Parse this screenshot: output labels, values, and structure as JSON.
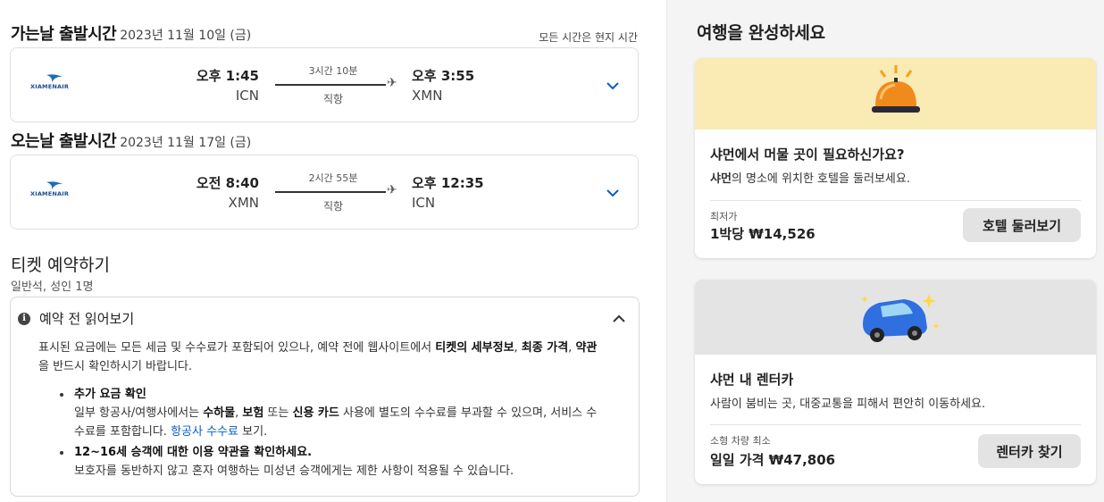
{
  "outbound": {
    "heading": "가는날 출발시간",
    "date": "2023년 11월 10일 (금)",
    "timezone_note": "모든 시간은 현지 시간",
    "airline": "XIAMENAIR",
    "depart_time": "오후 1:45",
    "depart_code": "ICN",
    "duration": "3시간 10분",
    "stops": "직항",
    "arrive_time": "오후 3:55",
    "arrive_code": "XMN"
  },
  "inbound": {
    "heading": "오는날 출발시간",
    "date": "2023년 11월 17일 (금)",
    "airline": "XIAMENAIR",
    "depart_time": "오전 8:40",
    "depart_code": "XMN",
    "duration": "2시간 55분",
    "stops": "직항",
    "arrive_time": "오후 12:35",
    "arrive_code": "ICN"
  },
  "ticket": {
    "title": "티켓 예약하기",
    "subtitle": "일반석, 성인 1명"
  },
  "notice": {
    "title": "예약 전 읽어보기",
    "intro_1": "표시된 요금에는 모든 세금 및 수수료가 포함되어 있으나, 예약 전에 웹사이트에서 ",
    "intro_bold_1": "티켓의 세부정보",
    "intro_2": ", ",
    "intro_bold_2": "최종 가격",
    "intro_3": ", ",
    "intro_bold_3": "약관",
    "intro_4": "을 반드시 확인하시기 바랍니다.",
    "bullet1_title": "추가 요금 확인",
    "bullet1_text_1": "일부 항공사/여행사에서는 ",
    "bullet1_bold_1": "수하물",
    "bullet1_text_2": ", ",
    "bullet1_bold_2": "보험",
    "bullet1_text_3": " 또는 ",
    "bullet1_bold_3": "신용 카드",
    "bullet1_text_4": " 사용에 별도의 수수료를 부과할 수 있으며, 서비스 수수료를 포함합니다. ",
    "bullet1_link": "항공사 수수료",
    "bullet1_text_5": " 보기.",
    "bullet2_title": "12~16세 승객에 대한 이용 약관을 확인하세요.",
    "bullet2_text": "보호자를 동반하지 않고 혼자 여행하는 미성년 승객에게는 제한 사항이 적용될 수 있습니다."
  },
  "sidebar": {
    "title": "여행을 완성하세요",
    "hotel": {
      "title": "샤먼에서 머물 곳이 필요하신가요?",
      "desc_bold": "샤먼",
      "desc": "의 명소에 위치한 호텔을 둘러보세요.",
      "price_label": "최저가",
      "price": "1박당 ₩14,526",
      "button": "호텔 둘러보기",
      "hero_color": "#faeab4"
    },
    "car": {
      "title": "샤먼 내 렌터카",
      "desc": "사람이 붐비는 곳, 대중교통을 피해서 편안히 이동하세요.",
      "price_label": "소형 차량 최소",
      "price": "일일 가격 ₩47,806",
      "button": "렌터카 찾기",
      "hero_color": "#e4e4e4"
    }
  },
  "colors": {
    "accent": "#0a5ec6",
    "airline_brand": "#1b4d8c"
  },
  "icons": [
    "airline-logo-icon",
    "plane-icon",
    "chevron-down-icon",
    "info-icon",
    "chevron-up-icon",
    "service-bell-icon",
    "car-icon"
  ]
}
